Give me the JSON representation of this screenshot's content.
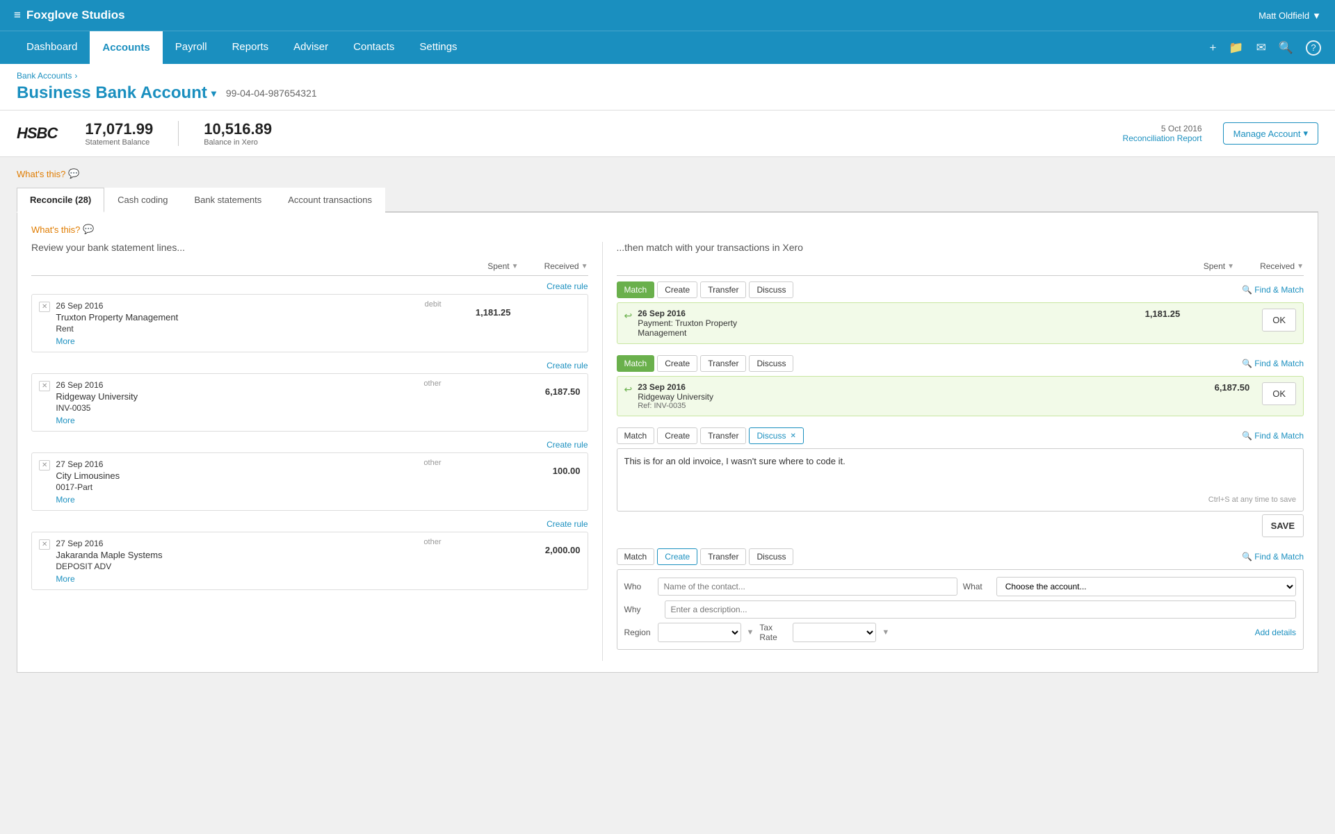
{
  "app": {
    "logo": "≡",
    "company": "Foxglove Studios",
    "user": "Matt Oldfield",
    "user_dropdown": "▼"
  },
  "nav": {
    "items": [
      {
        "label": "Dashboard",
        "active": false
      },
      {
        "label": "Accounts",
        "active": true
      },
      {
        "label": "Payroll",
        "active": false
      },
      {
        "label": "Reports",
        "active": false
      },
      {
        "label": "Adviser",
        "active": false
      },
      {
        "label": "Contacts",
        "active": false
      },
      {
        "label": "Settings",
        "active": false
      }
    ],
    "icons": [
      "+",
      "📁",
      "✉",
      "🔍",
      "?"
    ]
  },
  "breadcrumb": {
    "text": "Bank Accounts",
    "separator": "›"
  },
  "page": {
    "title": "Business Bank Account",
    "dropdown_arrow": "▾",
    "account_number": "99-04-04-987654321"
  },
  "account_summary": {
    "bank": "HSBC",
    "statement_balance": "17,071.99",
    "statement_balance_label": "Statement Balance",
    "xero_balance": "10,516.89",
    "xero_balance_label": "Balance in Xero",
    "recon_date": "5 Oct 2016",
    "recon_report": "Reconciliation Report",
    "manage_btn": "Manage Account",
    "manage_arrow": "▾"
  },
  "whats_this": "What's this?",
  "tabs": [
    {
      "label": "Reconcile (28)",
      "active": true
    },
    {
      "label": "Cash coding",
      "active": false
    },
    {
      "label": "Bank statements",
      "active": false
    },
    {
      "label": "Account transactions",
      "active": false
    }
  ],
  "whats_this_2": "What's this?",
  "left_panel": {
    "title": "Review your bank statement lines...",
    "col_spent": "Spent",
    "col_received": "Received",
    "sort_icon": "▼"
  },
  "right_panel": {
    "title": "...then match with your transactions in Xero",
    "col_spent": "Spent",
    "col_received": "Received",
    "sort_icon": "▼"
  },
  "statement_lines": [
    {
      "date": "26 Sep 2016",
      "type": "debit",
      "name": "Truxton Property Management",
      "ref": "Rent",
      "spent": "1,181.25",
      "received": "",
      "more": "More",
      "create_rule": "Create rule"
    },
    {
      "date": "26 Sep 2016",
      "type": "other",
      "name": "Ridgeway University",
      "ref": "INV-0035",
      "spent": "",
      "received": "6,187.50",
      "more": "More",
      "create_rule": "Create rule"
    },
    {
      "date": "27 Sep 2016",
      "type": "other",
      "name": "City Limousines",
      "ref": "0017-Part",
      "spent": "",
      "received": "100.00",
      "more": "More",
      "create_rule": "Create rule"
    },
    {
      "date": "27 Sep 2016",
      "type": "other",
      "name": "Jakaranda Maple Systems",
      "ref": "DEPOSIT ADV",
      "spent": "",
      "received": "2,000.00",
      "more": "More",
      "create_rule": "Create rule"
    }
  ],
  "match_blocks": [
    {
      "active_tab": "Match",
      "tabs": [
        "Match",
        "Create",
        "Transfer",
        "Discuss"
      ],
      "find_match": "Find & Match",
      "match_icon": "↩",
      "match_date": "26 Sep 2016",
      "match_name": "Payment: Truxton Property",
      "match_name2": "Management",
      "match_spent": "1,181.25",
      "match_received": "",
      "state": "matched"
    },
    {
      "active_tab": "Match",
      "tabs": [
        "Match",
        "Create",
        "Transfer",
        "Discuss"
      ],
      "find_match": "Find & Match",
      "match_icon": "↩",
      "match_date": "23 Sep 2016",
      "match_name": "Ridgeway University",
      "match_ref": "Ref: INV-0035",
      "match_spent": "",
      "match_received": "6,187.50",
      "state": "matched"
    },
    {
      "active_tab": "Discuss",
      "tabs": [
        "Match",
        "Create",
        "Transfer",
        "Discuss"
      ],
      "find_match": "Find & Match",
      "discuss_text": "This is for an old invoice, I wasn't sure where to code it.",
      "discuss_hint": "Ctrl+S at any time to save",
      "save_btn": "SAVE",
      "state": "discuss"
    },
    {
      "active_tab": "Create",
      "tabs": [
        "Match",
        "Create",
        "Transfer",
        "Discuss"
      ],
      "find_match": "Find & Match",
      "who_label": "Who",
      "who_placeholder": "Name of the contact...",
      "what_label": "What",
      "what_placeholder": "Choose the account...",
      "why_label": "Why",
      "why_placeholder": "Enter a description...",
      "region_label": "Region",
      "region_placeholder": "",
      "tax_label": "Tax Rate",
      "tax_placeholder": "",
      "add_details": "Add details",
      "state": "create"
    }
  ],
  "ok_btn": "OK",
  "save_btn": "SAVE"
}
